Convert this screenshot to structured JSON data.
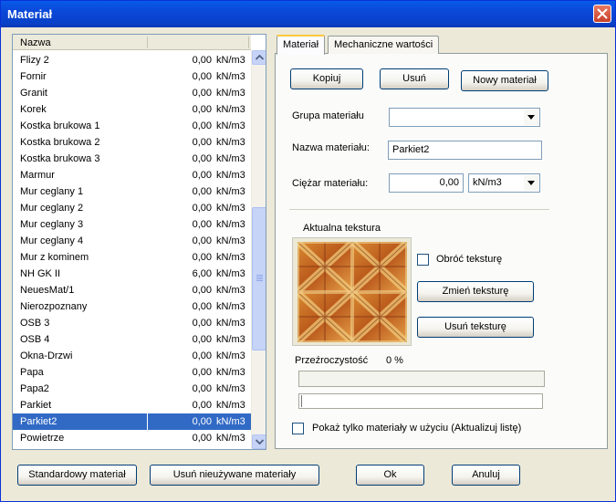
{
  "window": {
    "title": "Materiał"
  },
  "list": {
    "header": "Nazwa",
    "selected_index": 22,
    "items": [
      {
        "name": "Flizy 2",
        "value": "0,00",
        "unit": "kN/m3"
      },
      {
        "name": "Fornir",
        "value": "0,00",
        "unit": "kN/m3"
      },
      {
        "name": "Granit",
        "value": "0,00",
        "unit": "kN/m3"
      },
      {
        "name": "Korek",
        "value": "0,00",
        "unit": "kN/m3"
      },
      {
        "name": "Kostka brukowa 1",
        "value": "0,00",
        "unit": "kN/m3"
      },
      {
        "name": "Kostka brukowa 2",
        "value": "0,00",
        "unit": "kN/m3"
      },
      {
        "name": "Kostka brukowa 3",
        "value": "0,00",
        "unit": "kN/m3"
      },
      {
        "name": "Marmur",
        "value": "0,00",
        "unit": "kN/m3"
      },
      {
        "name": "Mur ceglany 1",
        "value": "0,00",
        "unit": "kN/m3"
      },
      {
        "name": "Mur ceglany 2",
        "value": "0,00",
        "unit": "kN/m3"
      },
      {
        "name": "Mur ceglany 3",
        "value": "0,00",
        "unit": "kN/m3"
      },
      {
        "name": "Mur ceglany 4",
        "value": "0,00",
        "unit": "kN/m3"
      },
      {
        "name": "Mur z kominem",
        "value": "0,00",
        "unit": "kN/m3"
      },
      {
        "name": "NH GK II",
        "value": "6,00",
        "unit": "kN/m3"
      },
      {
        "name": "NeuesMat/1",
        "value": "0,00",
        "unit": "kN/m3"
      },
      {
        "name": "Nierozpoznany",
        "value": "0,00",
        "unit": "kN/m3"
      },
      {
        "name": "OSB 3",
        "value": "0,00",
        "unit": "kN/m3"
      },
      {
        "name": "OSB 4",
        "value": "0,00",
        "unit": "kN/m3"
      },
      {
        "name": "Okna-Drzwi",
        "value": "0,00",
        "unit": "kN/m3"
      },
      {
        "name": "Papa",
        "value": "0,00",
        "unit": "kN/m3"
      },
      {
        "name": "Papa2",
        "value": "0,00",
        "unit": "kN/m3"
      },
      {
        "name": "Parkiet",
        "value": "0,00",
        "unit": "kN/m3"
      },
      {
        "name": "Parkiet2",
        "value": "0,00",
        "unit": "kN/m3"
      },
      {
        "name": "Powietrze",
        "value": "0,00",
        "unit": "kN/m3"
      }
    ]
  },
  "tabs": [
    {
      "label": "Materiał",
      "active": true
    },
    {
      "label": "Mechaniczne wartości",
      "active": false
    }
  ],
  "panel": {
    "copy_button": "Kopiuj",
    "delete_button": "Usuń",
    "new_button": "Nowy materiał",
    "group_label": "Grupa materiału",
    "group_value": "",
    "name_label": "Nazwa materiału:",
    "name_value": "Parkiet2",
    "weight_label": "Ciężar materiału:",
    "weight_value": "0,00",
    "weight_unit": "kN/m3",
    "texture_group": "Aktualna tekstura",
    "rotate_label": "Obróć teksturę",
    "change_texture_button": "Zmień teksturę",
    "remove_texture_button": "Usuń teksturę",
    "transparency_label": "Przeźroczystość",
    "transparency_value": "0 %",
    "transparency_fraction": 0,
    "show_used_label": "Pokaż tylko materiały w użyciu (Aktualizuj listę)"
  },
  "footer": {
    "standard_button": "Standardowy materiał",
    "remove_unused_button": "Usuń nieużywane materiały",
    "ok_button": "Ok",
    "cancel_button": "Anuluj"
  },
  "colors": {
    "title_bar": "#0a48d8",
    "selection": "#316ac5",
    "face": "#ece9d8"
  }
}
